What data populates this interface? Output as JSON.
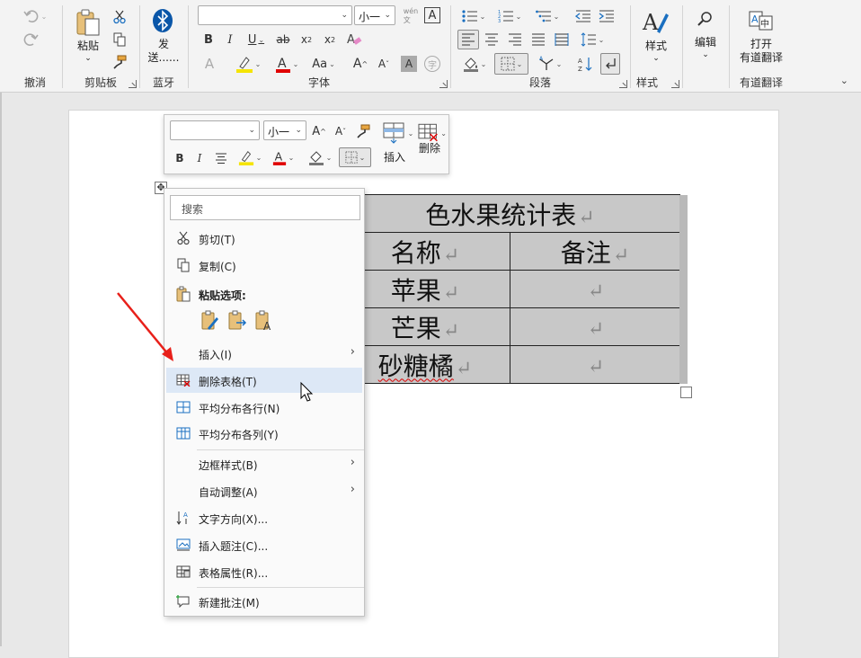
{
  "ribbon": {
    "groups": {
      "undo": "撤消",
      "clipboard": "剪贴板",
      "bluetooth": "蓝牙",
      "font": "字体",
      "paragraph": "段落",
      "styles": "样式",
      "youdao": "有道翻译"
    },
    "clipboard": {
      "paste_label": "粘贴"
    },
    "bluetooth": {
      "send_label": "发\n送......"
    },
    "font": {
      "size_value": "小一",
      "font_value": ""
    },
    "styles": {
      "styles_label": "样式"
    },
    "editing": {
      "editing_label": "编辑"
    },
    "youdao": {
      "open_label": "打开",
      "translate_label": "有道翻译"
    }
  },
  "mini_toolbar": {
    "size_value": "小一",
    "insert_label": "插入",
    "delete_label": "删除"
  },
  "table": {
    "title": "色水果统计表",
    "header": [
      "名称",
      "备注"
    ],
    "rows": [
      [
        "苹果",
        ""
      ],
      [
        "芒果",
        ""
      ],
      [
        "砂糖橘",
        ""
      ]
    ],
    "para_mark": "↵"
  },
  "context_menu": {
    "search_placeholder": "搜索",
    "items": {
      "cut": "剪切(T)",
      "copy": "复制(C)",
      "paste_options": "粘贴选项:",
      "insert": "插入(I)",
      "delete_table": "删除表格(T)",
      "distribute_rows": "平均分布各行(N)",
      "distribute_cols": "平均分布各列(Y)",
      "border_style": "边框样式(B)",
      "autofit": "自动调整(A)",
      "text_direction": "文字方向(X)...",
      "insert_caption": "插入题注(C)...",
      "table_properties": "表格属性(R)...",
      "new_comment": "新建批注(M)"
    }
  },
  "colors": {
    "highlight": "#f5e400",
    "font_red": "#e00000",
    "arrow_red": "#e8201a",
    "hover": "#dde8f6"
  }
}
